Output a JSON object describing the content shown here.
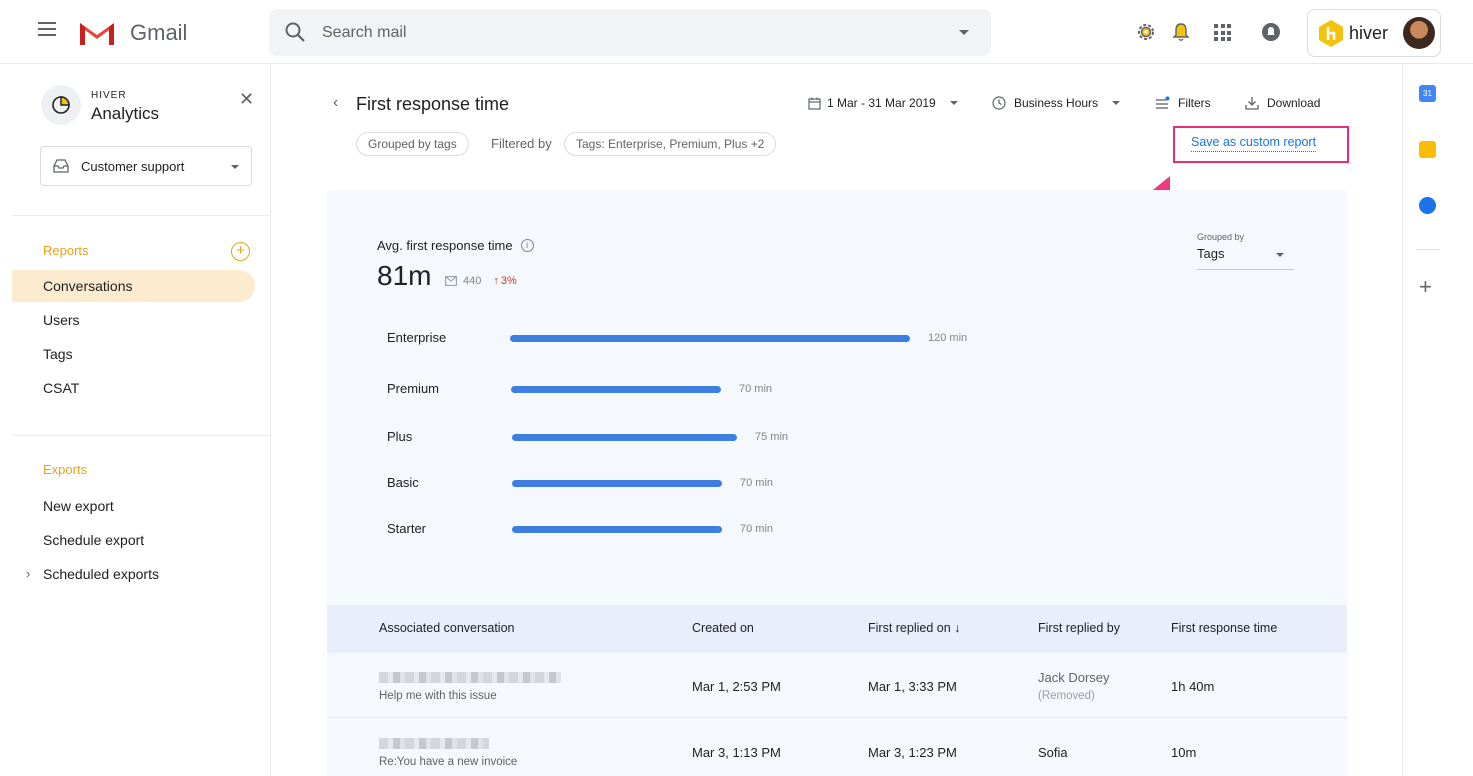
{
  "gmail": {
    "brand": "Gmail",
    "search_placeholder": "Search mail"
  },
  "account": {
    "brand": "hiver"
  },
  "sidebar": {
    "brand_small": "HIVER",
    "brand_big": "Analytics",
    "inbox": "Customer support",
    "reports_title": "Reports",
    "reports_items": [
      {
        "label": "Conversations",
        "active": true
      },
      {
        "label": "Users"
      },
      {
        "label": "Tags"
      },
      {
        "label": "CSAT"
      }
    ],
    "exports_title": "Exports",
    "exports_items": [
      {
        "label": "New export"
      },
      {
        "label": "Schedule export"
      },
      {
        "label": "Scheduled exports"
      }
    ]
  },
  "report": {
    "title": "First response time",
    "date_range": "1 Mar - 31 Mar 2019",
    "hours": "Business Hours",
    "filters": "Filters",
    "download": "Download",
    "grouped_chip": "Grouped by tags",
    "filtered_by": "Filtered by",
    "filter_chip": "Tags: Enterprise, Premium, Plus +2",
    "save_custom": "Save as custom report"
  },
  "metric": {
    "label": "Avg. first response time",
    "value": "81m",
    "count": "440",
    "delta": "3%"
  },
  "grouping": {
    "label": "Grouped by",
    "value": "Tags"
  },
  "chart_data": {
    "type": "bar",
    "orientation": "horizontal",
    "categories": [
      "Enterprise",
      "Premium",
      "Plus",
      "Basic",
      "Starter"
    ],
    "values": [
      120,
      70,
      75,
      70,
      70
    ],
    "value_labels": [
      "120 min",
      "70 min",
      "75 min",
      "70 min",
      "70 min"
    ],
    "unit": "min",
    "bar_color": "#3d7ee0"
  },
  "table": {
    "headers": [
      "Associated conversation",
      "Created on",
      "First replied on ↓",
      "First replied by",
      "First response time"
    ],
    "rows": [
      {
        "subject": "Help me with this issue",
        "created": "Mar 1, 2:53 PM",
        "replied": "Mar 1, 3:33 PM",
        "by": "Jack Dorsey",
        "by_note": "(Removed)",
        "time": "1h 40m"
      },
      {
        "subject": "Re:You have a new invoice",
        "created": "Mar 3, 1:13 PM",
        "replied": "Mar 3, 1:23 PM",
        "by": "Sofia",
        "by_note": "",
        "time": "10m"
      }
    ]
  },
  "colors": {
    "accent_orange": "#e8a317",
    "highlight_pink": "#ec2a7b",
    "link_blue": "#1a73e8"
  }
}
